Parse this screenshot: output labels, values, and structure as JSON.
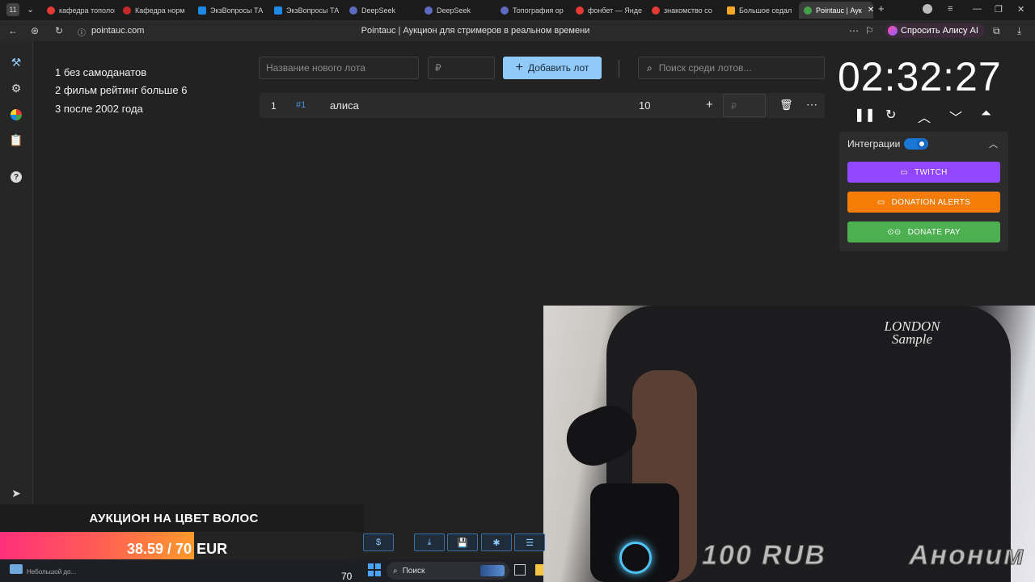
{
  "browser": {
    "tabs": [
      {
        "label": "кафедра тополог",
        "color": "#e53935"
      },
      {
        "label": "Кафедра норм",
        "color": "#c62828"
      },
      {
        "label": "ЭкзВопросы ТА",
        "color": "#1e88e5"
      },
      {
        "label": "ЭкзВопросы ТА",
        "color": "#1e88e5"
      },
      {
        "label": "DeepSeek",
        "color": "#5c6bc0"
      },
      {
        "label": "DeepSeek",
        "color": "#5c6bc0"
      },
      {
        "label": "Топография ор",
        "color": "#5c6bc0"
      },
      {
        "label": "фонбет — Янде",
        "color": "#e53935"
      },
      {
        "label": "знакомство со",
        "color": "#e53935"
      },
      {
        "label": "Большое седал",
        "color": "#f9a825"
      },
      {
        "label": "Pointauc | Аук",
        "color": "#43a047"
      }
    ],
    "address": "pointauc.com",
    "page_title": "Pointauc | Аукцион для стримеров в реальном времени",
    "alice_button": "Спросить Алису AI"
  },
  "notes": [
    "1 без самоданатов",
    "2 фильм рейтинг больше 6",
    "3 после 2002 года"
  ],
  "toolbar": {
    "lot_name_placeholder": "Название нового лота",
    "amount_placeholder": "₽",
    "add_label": "Добавить лот",
    "search_placeholder": "Поиск среди лотов..."
  },
  "lots": [
    {
      "index": "1",
      "id": "#1",
      "name": "алиса",
      "amount": "10",
      "plus": "+",
      "input_placeholder": "₽"
    }
  ],
  "timer": {
    "value": "02:32:27"
  },
  "integrations": {
    "title": "Интеграции",
    "enabled": true,
    "buttons": [
      {
        "label": "TWITCH",
        "color": "#9146ff"
      },
      {
        "label": "DONATION ALERTS",
        "color": "#f57d07"
      },
      {
        "label": "DONATE PAY",
        "color": "#4caf50"
      }
    ]
  },
  "stream_overlay": {
    "auction_title": "АУКЦИОН НА ЦВЕТ ВОЛОС",
    "goal_text": "38.59 / 70",
    "goal_currency": "EUR",
    "goal_progress": 0.551,
    "donation_amount": "100 RUB",
    "donor_name": "Аноним",
    "shirt_text": "LONDON Sample",
    "count": "70"
  },
  "taskbar": {
    "search_label": "Поиск",
    "notification": "Небольшой до..."
  }
}
